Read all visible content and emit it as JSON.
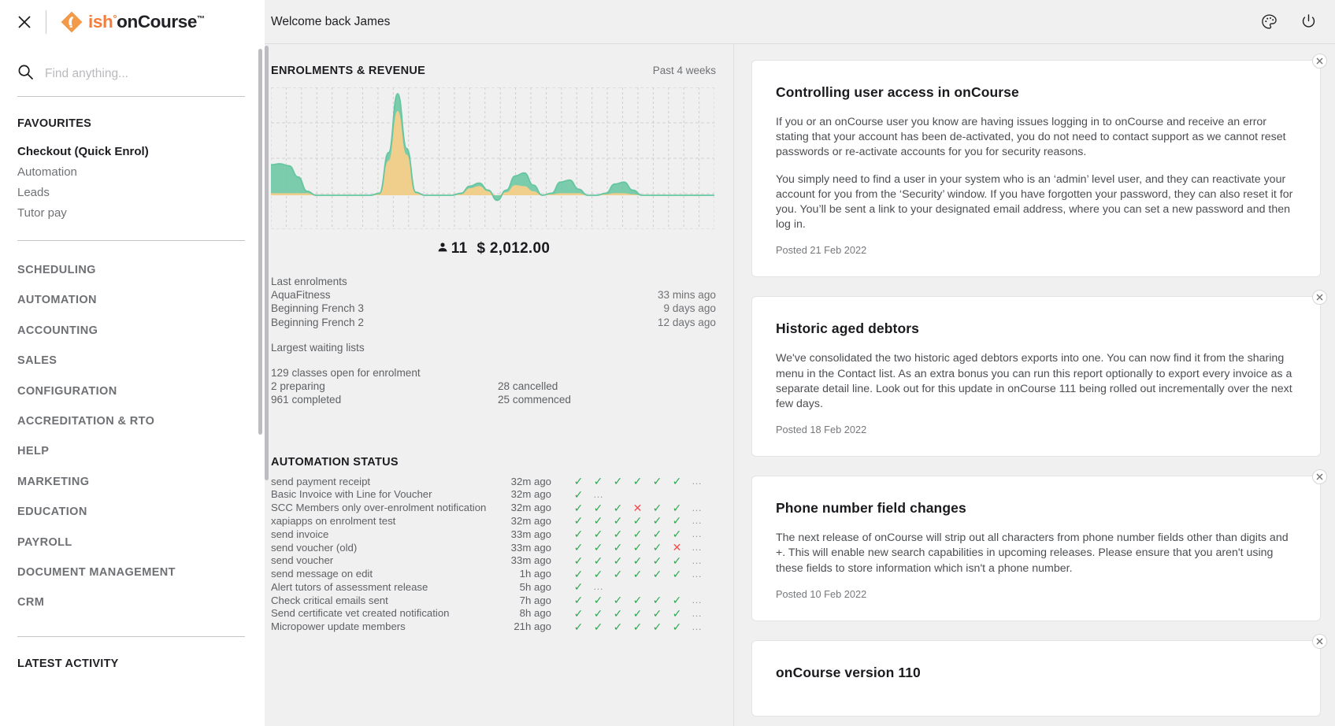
{
  "sidebar": {
    "close_icon": "close-icon",
    "logo": {
      "ish": "ish",
      "degree": "°",
      "oncourse": "onCourse",
      "tm": "™"
    },
    "search": {
      "placeholder": "Find anything...",
      "value": "",
      "icon": "search-icon"
    },
    "favourites_heading": "FAVOURITES",
    "favourites": [
      {
        "label": "Checkout (Quick Enrol)",
        "active": true
      },
      {
        "label": "Automation",
        "active": false
      },
      {
        "label": "Leads",
        "active": false
      },
      {
        "label": "Tutor pay",
        "active": false
      }
    ],
    "nav": [
      {
        "label": "SCHEDULING"
      },
      {
        "label": "AUTOMATION"
      },
      {
        "label": "ACCOUNTING"
      },
      {
        "label": "SALES"
      },
      {
        "label": "CONFIGURATION"
      },
      {
        "label": "ACCREDITATION & RTO"
      },
      {
        "label": "HELP"
      },
      {
        "label": "MARKETING"
      },
      {
        "label": "EDUCATION"
      },
      {
        "label": "PAYROLL"
      },
      {
        "label": "DOCUMENT MANAGEMENT"
      },
      {
        "label": "CRM"
      }
    ],
    "latest_activity_heading": "LATEST ACTIVITY"
  },
  "topbar": {
    "welcome": "Welcome back James",
    "palette_icon": "palette-icon",
    "power_icon": "power-icon"
  },
  "dashboard": {
    "panel_title": "ENROLMENTS & REVENUE",
    "panel_period": "Past 4 weeks",
    "totals": {
      "enrolments": "11",
      "revenue": "$ 2,012.00",
      "person_icon": "person-icon"
    },
    "last_enrolments_label": "Last enrolments",
    "last_enrolments": [
      {
        "name": "AquaFitness",
        "when": "33 mins ago"
      },
      {
        "name": "Beginning French 3",
        "when": "9 days ago"
      },
      {
        "name": "Beginning French 2",
        "when": "12 days ago"
      }
    ],
    "waiting_lists_label": "Largest waiting lists",
    "classes_open": "129 classes open for enrolment",
    "class_stats": [
      {
        "left": "2 preparing",
        "right": "28 cancelled"
      },
      {
        "left": "961 completed",
        "right": "25 commenced"
      }
    ],
    "automation_title": "AUTOMATION STATUS",
    "automation_rows": [
      {
        "name": "send payment receipt",
        "time": "32m ago",
        "marks": [
          "ok",
          "ok",
          "ok",
          "ok",
          "ok",
          "ok",
          "dots"
        ]
      },
      {
        "name": "Basic Invoice with Line for Voucher",
        "time": "32m ago",
        "marks": [
          "ok",
          "dots"
        ]
      },
      {
        "name": "SCC Members only over-enrolment notification",
        "time": "32m ago",
        "marks": [
          "ok",
          "ok",
          "ok",
          "bad",
          "ok",
          "ok",
          "dots"
        ]
      },
      {
        "name": "xapiapps on enrolment test",
        "time": "32m ago",
        "marks": [
          "ok",
          "ok",
          "ok",
          "ok",
          "ok",
          "ok",
          "dots"
        ]
      },
      {
        "name": "send invoice",
        "time": "33m ago",
        "marks": [
          "ok",
          "ok",
          "ok",
          "ok",
          "ok",
          "ok",
          "dots"
        ]
      },
      {
        "name": "send voucher (old)",
        "time": "33m ago",
        "marks": [
          "ok",
          "ok",
          "ok",
          "ok",
          "ok",
          "bad",
          "dots"
        ]
      },
      {
        "name": "send voucher",
        "time": "33m ago",
        "marks": [
          "ok",
          "ok",
          "ok",
          "ok",
          "ok",
          "ok",
          "dots"
        ]
      },
      {
        "name": "send message on edit",
        "time": "1h ago",
        "marks": [
          "ok",
          "ok",
          "ok",
          "ok",
          "ok",
          "ok",
          "dots"
        ]
      },
      {
        "name": "Alert tutors of assessment release",
        "time": "5h ago",
        "marks": [
          "ok",
          "dots"
        ]
      },
      {
        "name": "Check critical emails sent",
        "time": "7h ago",
        "marks": [
          "ok",
          "ok",
          "ok",
          "ok",
          "ok",
          "ok",
          "dots"
        ]
      },
      {
        "name": "Send certificate vet created notification",
        "time": "8h ago",
        "marks": [
          "ok",
          "ok",
          "ok",
          "ok",
          "ok",
          "ok",
          "dots"
        ]
      },
      {
        "name": "Micropower update members",
        "time": "21h ago",
        "marks": [
          "ok",
          "ok",
          "ok",
          "ok",
          "ok",
          "ok",
          "dots"
        ]
      }
    ]
  },
  "chart_data": {
    "type": "area",
    "title": "ENROLMENTS & REVENUE",
    "subtitle": "Past 4 weeks",
    "xlabel": "",
    "ylabel": "",
    "grid": true,
    "legend": null,
    "colors": {
      "enrolments": "#66c6a0",
      "revenue": "#f7ce8a"
    },
    "series": [
      {
        "name": "Enrolments",
        "color": "#66c6a0",
        "values": [
          0.3,
          0.31,
          0.29,
          0.18,
          0.04,
          0.0,
          0.0,
          0.0,
          0.0,
          0.0,
          0.0,
          0.0,
          0.02,
          0.42,
          1.0,
          0.46,
          0.03,
          0.0,
          0.0,
          0.0,
          0.0,
          0.02,
          0.09,
          0.12,
          0.05,
          -0.05,
          0.05,
          0.19,
          0.22,
          0.1,
          0.0,
          0.02,
          0.13,
          0.15,
          0.06,
          0.0,
          0.0,
          0.02,
          0.11,
          0.13,
          0.05,
          0.0,
          0.0,
          0.0,
          0.0,
          0.0,
          0.0,
          0.0,
          0.0,
          0.0
        ]
      },
      {
        "name": "Revenue",
        "color": "#f7ce8a",
        "values": [
          0.02,
          0.02,
          0.02,
          0.02,
          0.02,
          0.0,
          0.0,
          0.0,
          0.0,
          0.0,
          0.0,
          0.0,
          0.01,
          0.34,
          0.83,
          0.4,
          0.02,
          0.0,
          0.0,
          0.0,
          0.0,
          0.01,
          0.07,
          0.09,
          0.04,
          0.0,
          0.03,
          0.1,
          0.09,
          0.04,
          0.0,
          0.01,
          0.02,
          0.02,
          0.02,
          0.0,
          0.0,
          0.01,
          0.02,
          0.02,
          0.01,
          0.0,
          0.0,
          0.0,
          0.0,
          0.0,
          0.0,
          0.0,
          0.0,
          0.0
        ]
      }
    ],
    "summary": {
      "enrolments_total": 11,
      "revenue_total": "$ 2,012.00"
    }
  },
  "news": {
    "close_icon": "close-icon",
    "cards": [
      {
        "title": "Controlling user access in onCourse",
        "paragraphs": [
          "If you or an onCourse user you know are having issues logging in to onCourse and receive an error stating that your account has been de-activated, you do not need to contact support as we cannot reset passwords or re-activate accounts for you for security reasons.",
          "You simply need to find a user in your system who is an ‘admin’ level user, and they can reactivate your account for you from the ‘Security’ window. If you have forgotten your password, they can also reset it for you. You’ll be sent a link to your designated email address, where you can set a new password and then log in."
        ],
        "date": "Posted 21 Feb 2022"
      },
      {
        "title": "Historic aged debtors",
        "paragraphs": [
          "We've consolidated the two historic aged debtors exports into one. You can now find it from the sharing menu in the Contact list. As an extra bonus you can run this report optionally to export every invoice as a separate detail line. Look out for this update in onCourse 111 being rolled out incrementally over the next few days."
        ],
        "date": "Posted 18 Feb 2022"
      },
      {
        "title": "Phone number field changes",
        "paragraphs": [
          "The next release of onCourse will strip out all characters from phone number fields other than digits and +. This will enable new search capabilities in upcoming releases. Please ensure that you aren't using these fields to store information which isn't a phone number."
        ],
        "date": "Posted 10 Feb 2022"
      },
      {
        "title": "onCourse version 110",
        "paragraphs": [],
        "date": ""
      }
    ]
  }
}
